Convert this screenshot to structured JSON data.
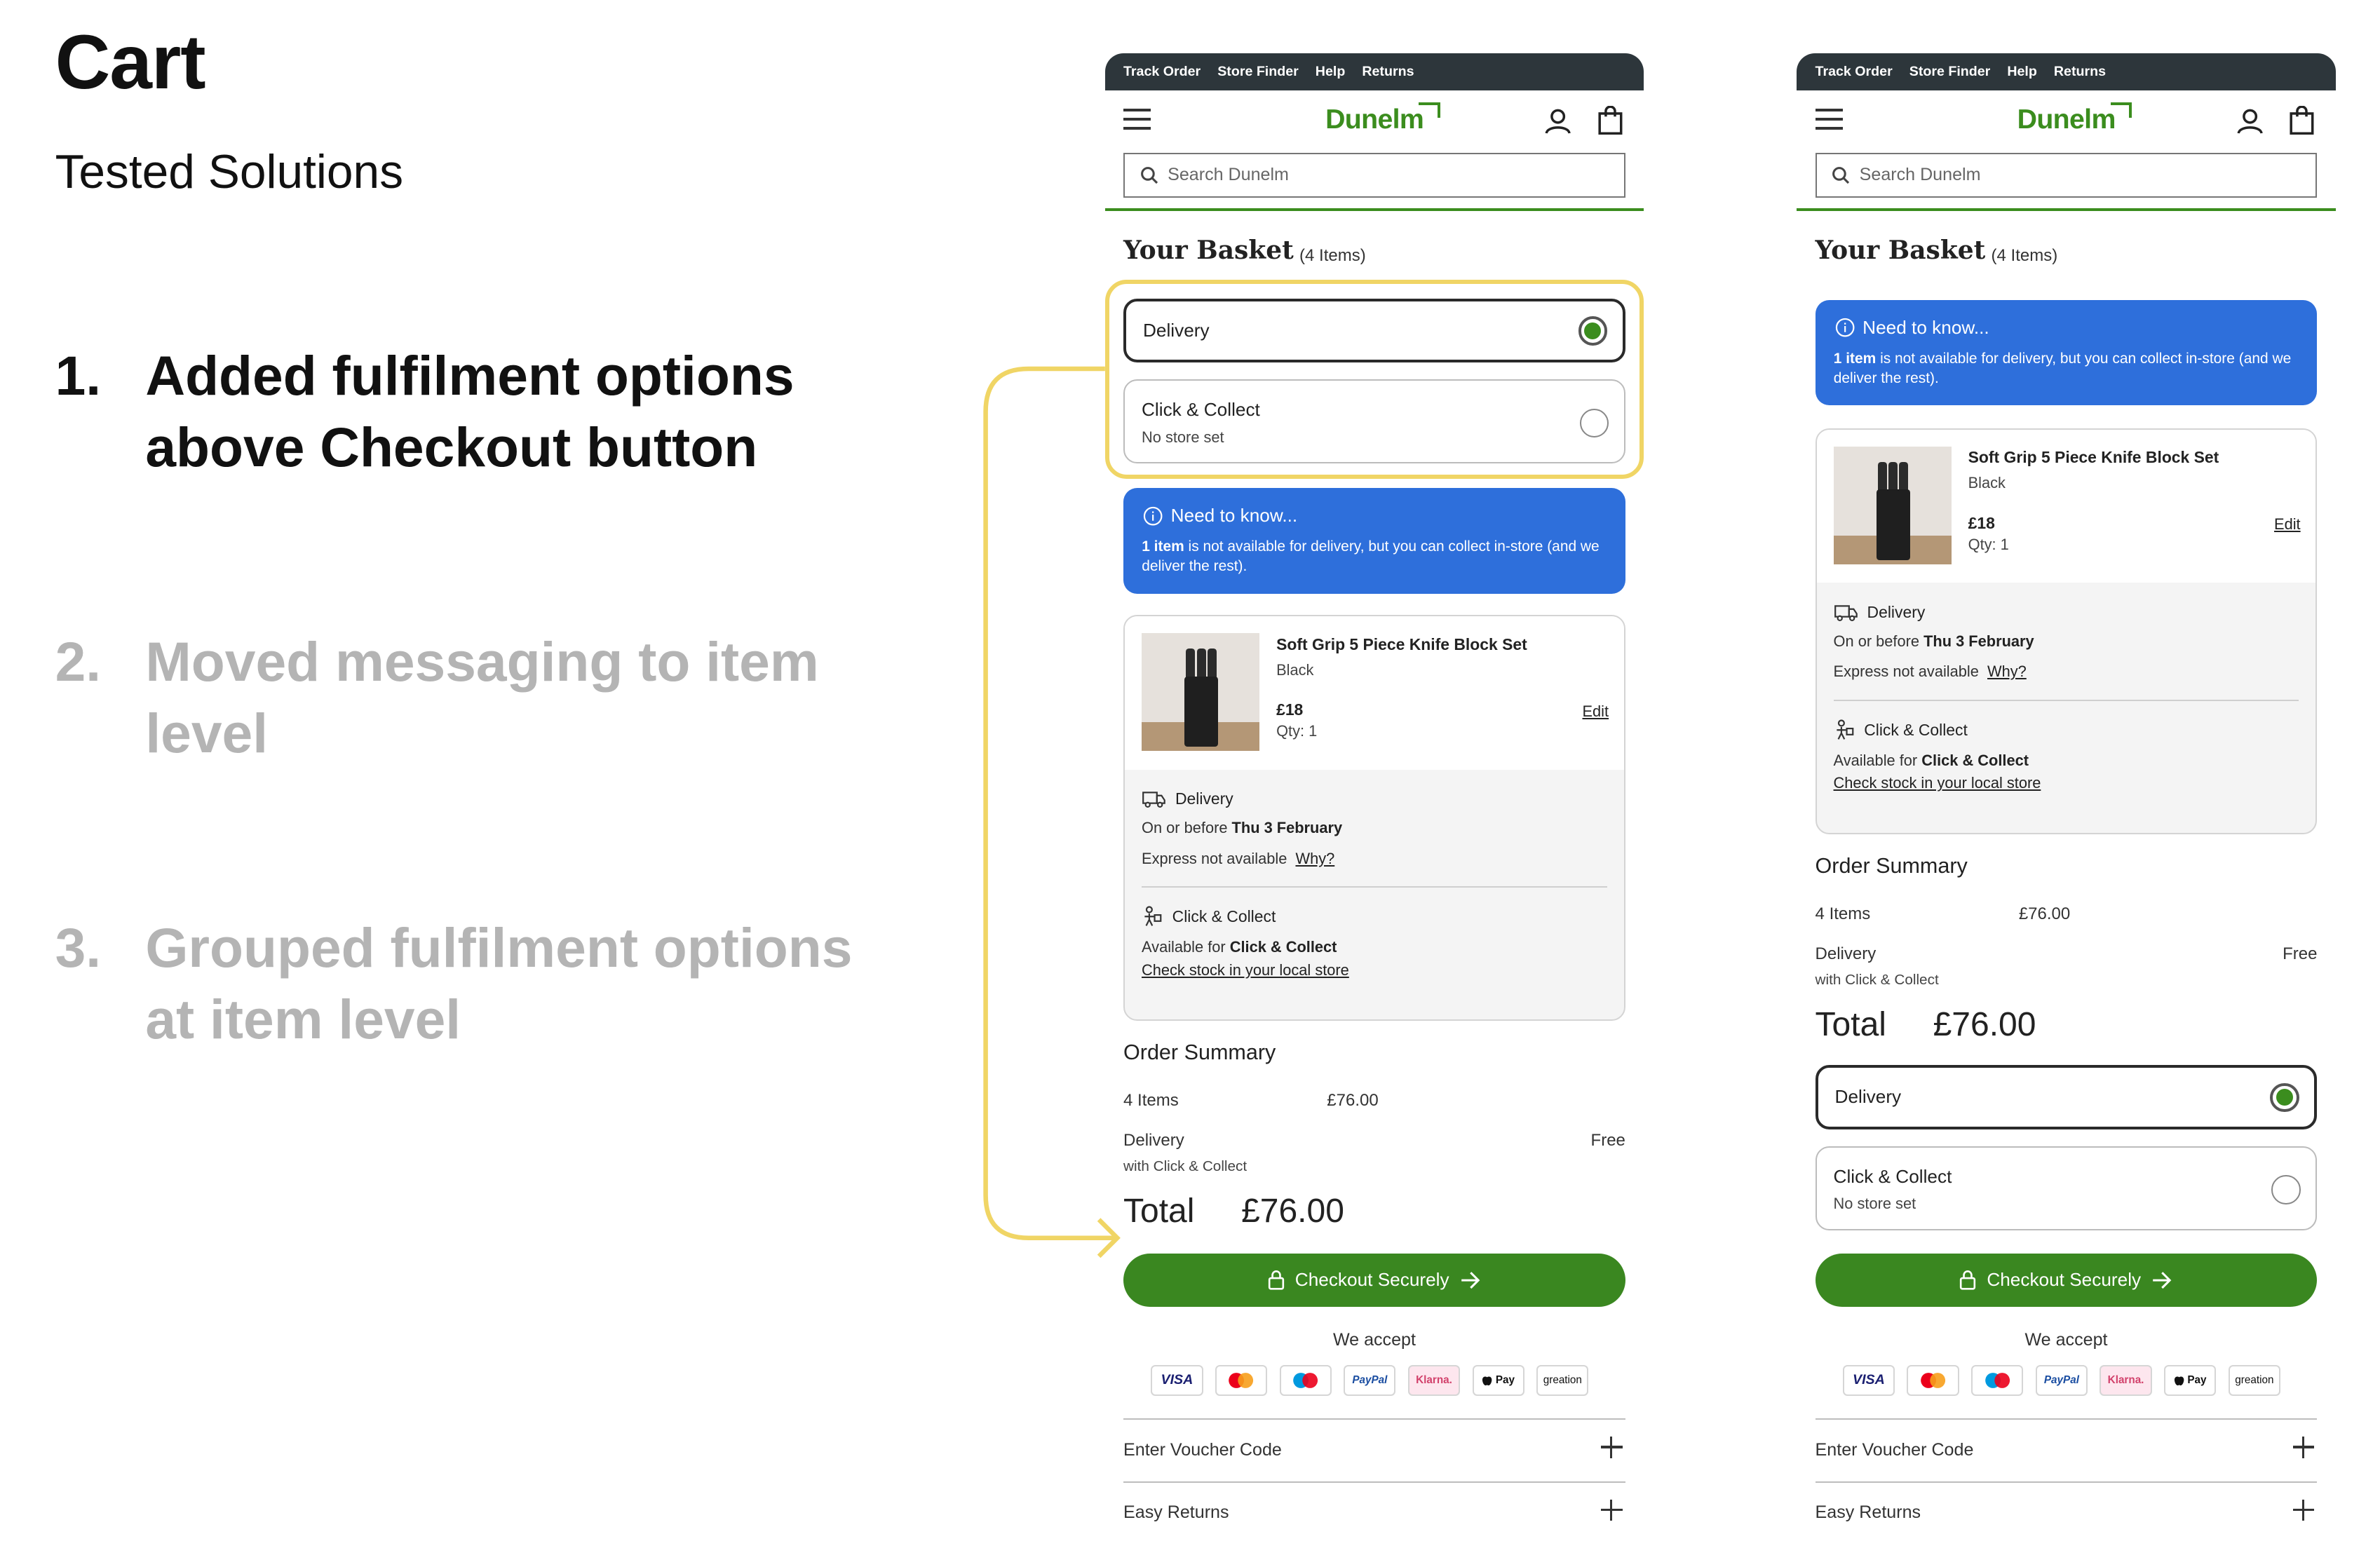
{
  "title": "Cart",
  "subtitle": "Tested Solutions",
  "solutions": [
    {
      "num": "1.",
      "text": "Added fulfilment options above Checkout button",
      "active": true
    },
    {
      "num": "2.",
      "text": "Moved messaging to item level",
      "active": false
    },
    {
      "num": "3.",
      "text": "Grouped fulfilment options at item level",
      "active": false
    }
  ],
  "colors": {
    "brand_green": "#3b8d1e",
    "info_blue": "#2e6fdb",
    "highlight": "#f0d565",
    "topbar": "#2d363b"
  },
  "phone": {
    "topnav": [
      "Track Order",
      "Store Finder",
      "Help",
      "Returns"
    ],
    "logo": "Dunelm",
    "search_placeholder": "Search Dunelm",
    "basket_title": "Your Basket",
    "basket_count": "(4 Items)",
    "delivery_option": "Delivery",
    "collect_option": "Click & Collect",
    "collect_sub": "No store set",
    "info_title": "Need to know...",
    "info_bold": "1 item",
    "info_body": " is not available for delivery, but you can collect in-store (and we deliver the rest).",
    "item": {
      "name": "Soft Grip 5 Piece Knife Block Set",
      "colour": "Black",
      "price": "£18",
      "qty": "Qty: 1",
      "edit": "Edit",
      "delivery_head": "Delivery",
      "delivery_line_pre": "On or before ",
      "delivery_date": "Thu 3 February",
      "express": "Express not available",
      "why": "Why?",
      "collect_head": "Click & Collect",
      "collect_pre": "Available for ",
      "collect_bold": "Click & Collect",
      "check_stock": "Check stock in your local store"
    },
    "order_summary": {
      "heading": "Order Summary",
      "items_label": "4 Items",
      "items_value": "£76.00",
      "delivery_label": "Delivery",
      "delivery_value": "Free",
      "delivery_sub": "with Click & Collect",
      "total_label": "Total",
      "total_value": "£76.00"
    },
    "checkout": "Checkout Securely",
    "we_accept": "We accept",
    "payments": [
      "VISA",
      "mastercard",
      "maestro",
      "PayPal",
      "Klarna.",
      "Pay",
      "greation"
    ],
    "voucher": "Enter Voucher Code",
    "returns": "Easy Returns"
  }
}
